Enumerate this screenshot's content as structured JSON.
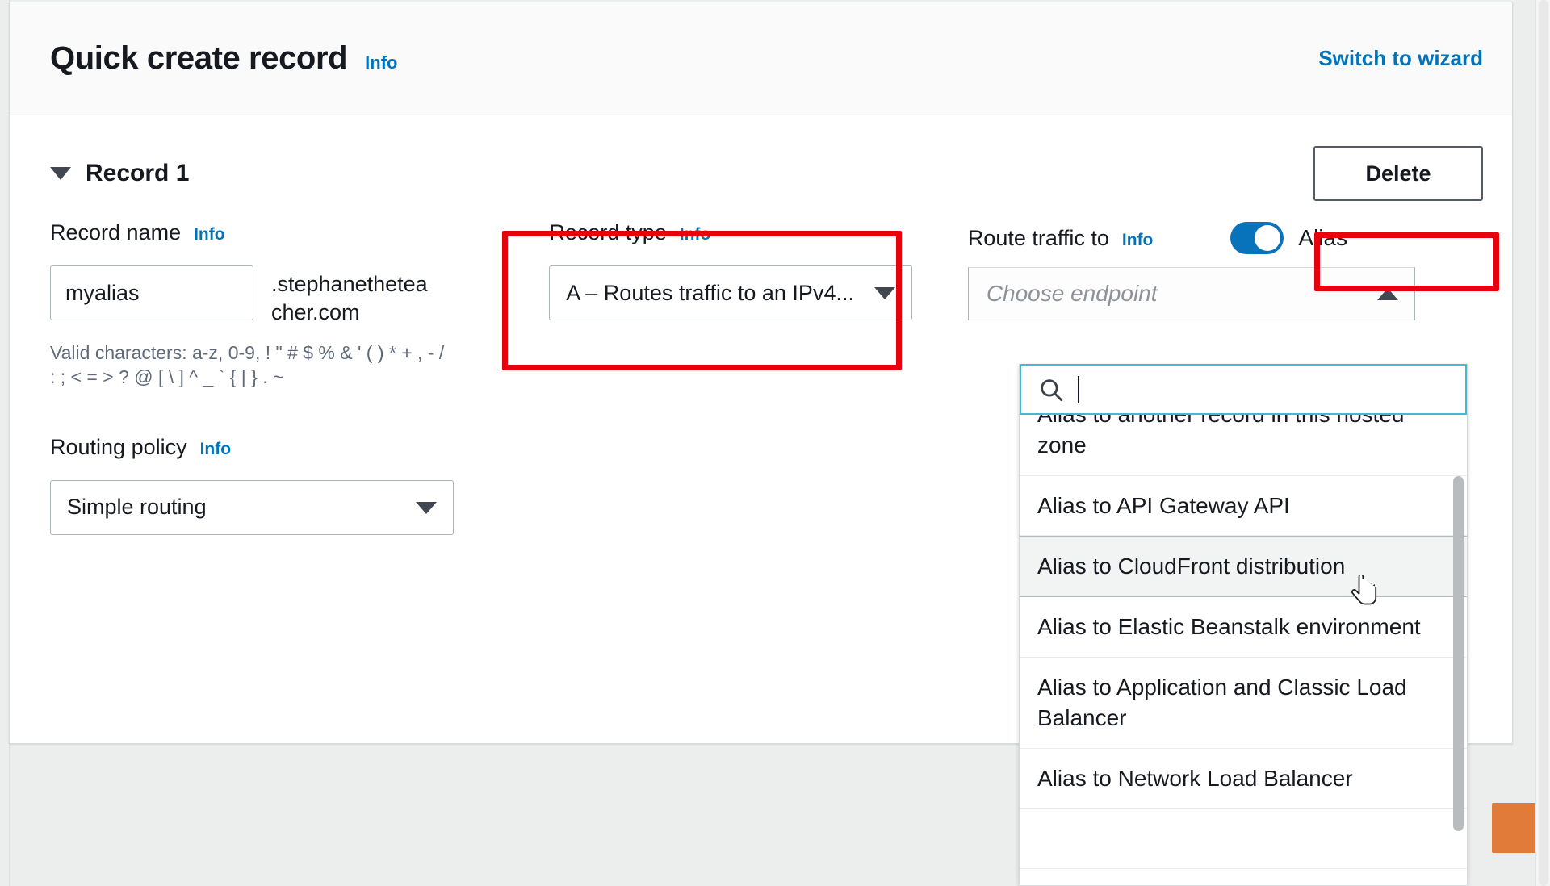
{
  "header": {
    "title": "Quick create record",
    "info_label": "Info",
    "switch_link": "Switch to wizard"
  },
  "record": {
    "title": "Record 1",
    "delete_label": "Delete",
    "collapse_icon": "caret-down-icon"
  },
  "record_name": {
    "label": "Record name",
    "info_label": "Info",
    "value": "myalias",
    "placeholder": "",
    "domain_suffix": ".stephanethetea cher.com",
    "hint": "Valid characters: a-z, 0-9, ! \" # $ % & ' ( ) * + , - / : ; < = > ? @ [ \\ ] ^ _ ` { | } . ~"
  },
  "routing_policy": {
    "label": "Routing policy",
    "info_label": "Info",
    "value": "Simple routing",
    "caret_icon": "chevron-down-icon"
  },
  "record_type": {
    "label": "Record type",
    "info_label": "Info",
    "value": "A – Routes traffic to an IPv4...",
    "caret_icon": "chevron-down-icon"
  },
  "route_traffic": {
    "label": "Route traffic to",
    "info_label": "Info",
    "alias_label": "Alias",
    "alias_enabled": true,
    "endpoint_placeholder": "Choose endpoint",
    "caret_icon": "chevron-up-icon",
    "search_placeholder": "",
    "search_value": "",
    "search_icon": "search-icon",
    "options": [
      "Alias to another record in this hosted zone",
      "Alias to API Gateway API",
      "Alias to CloudFront distribution",
      "Alias to Elastic Beanstalk environment",
      "Alias to Application and Classic Load Balancer",
      "Alias to Network Load Balancer"
    ],
    "highlighted_option": "Alias to CloudFront distribution"
  },
  "colors": {
    "accent_blue": "#0073bb",
    "toggle_on": "#0873bb",
    "annotation_red": "#e8000d",
    "focus_border": "#44b9d6",
    "orange_button": "#e07b39"
  }
}
